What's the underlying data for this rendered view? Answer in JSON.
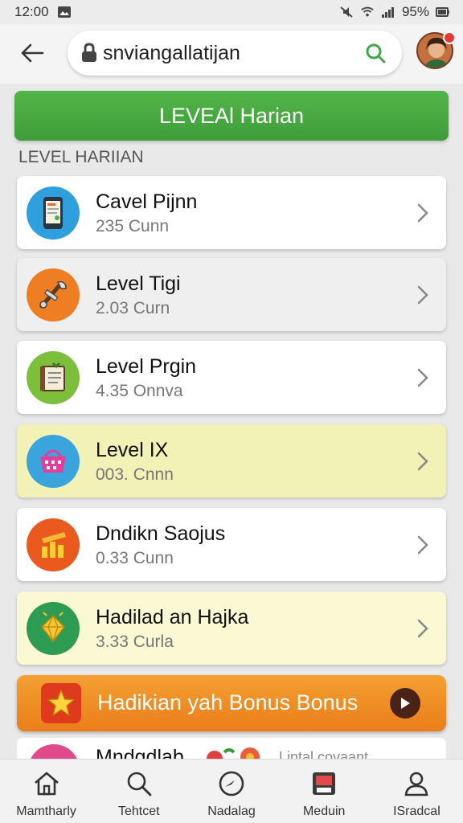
{
  "status_bar": {
    "time": "12:00",
    "battery": "95%",
    "icons": [
      "gallery-icon",
      "mute-icon",
      "wifi-icon",
      "signal-icon",
      "battery-icon"
    ]
  },
  "app_bar": {
    "search_text": "snviangallatijan",
    "icons": [
      "back-arrow-icon",
      "lock-icon",
      "search-icon",
      "avatar"
    ]
  },
  "banner": {
    "label": "LEVEAl Harian"
  },
  "section": {
    "title": "LEVEL HARIIAN"
  },
  "levels": [
    {
      "title": "Cavel Pijnn",
      "subtitle": "235  Cunn",
      "icon": "tablet-icon",
      "color": "#2f9fdd"
    },
    {
      "title": "Level Tigi",
      "subtitle": "2.03  Curn",
      "icon": "tools-icon",
      "color": "#ef7d22"
    },
    {
      "title": "Level Prgin",
      "subtitle": "4.35  Onnva",
      "icon": "notebook-icon",
      "color": "#7cbf3b"
    },
    {
      "title": "Level IX",
      "subtitle": "003.  Cnnn",
      "icon": "basket-icon",
      "color": "#3aa4dd"
    },
    {
      "title": "Dndikn Saojus",
      "subtitle": "0.33  Cunn",
      "icon": "bars-icon",
      "color": "#ea5a1f"
    },
    {
      "title": "Hadilad an Hajka",
      "subtitle": "3.33  Curla",
      "icon": "diamond-icon",
      "color": "#2e9b52"
    }
  ],
  "bonus": {
    "label": "Hadikian yah Bonus Bonus",
    "icon": "star-icon"
  },
  "partial_item": {
    "title": "Mndgdlab",
    "right_text": "Lintal covaant"
  },
  "bottom_nav": [
    {
      "label": "Mamtharly",
      "icon": "home-icon"
    },
    {
      "label": "Tehtcet",
      "icon": "search-icon"
    },
    {
      "label": "Nadalag",
      "icon": "compass-icon"
    },
    {
      "label": "Meduin",
      "icon": "device-icon"
    },
    {
      "label": "ISradcal",
      "icon": "person-icon"
    }
  ],
  "colors": {
    "accent_green": "#4caf50",
    "bonus_orange": "#f08a24",
    "highlight_yellow": "#f2f1b6"
  }
}
